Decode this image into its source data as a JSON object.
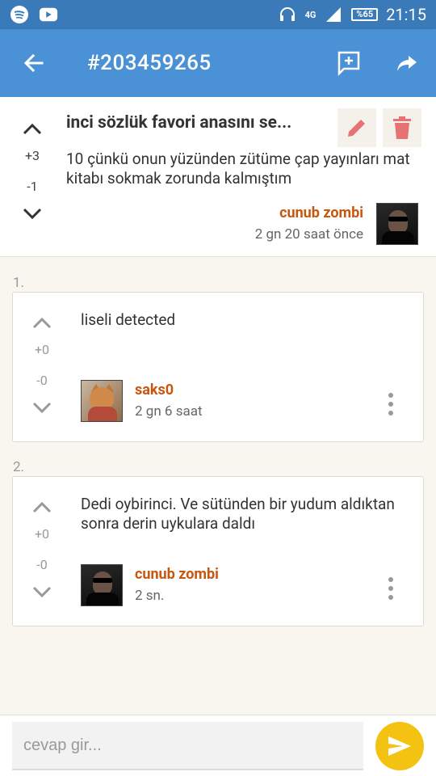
{
  "status_bar": {
    "network_label": "4G",
    "battery_label": "%65",
    "time": "21:15"
  },
  "app_bar": {
    "title": "#203459265"
  },
  "entry": {
    "title": "inci sözlük favori anasını se...",
    "text": "10 çünkü onun yüzünden zütüme çap yayınları mat kitabı sokmak zorunda kalmıştım",
    "upvotes": "+3",
    "downvotes": "-1",
    "author": "cunub zombi",
    "date": "2 gn 20 saat  önce"
  },
  "comments": [
    {
      "index": "1.",
      "text": "liseli detected",
      "upvotes": "+0",
      "downvotes": "-0",
      "author": "saks0",
      "date": "2 gn 6 saat"
    },
    {
      "index": "2.",
      "text": "Dedi oybirinci. Ve sütünden bir yudum aldıktan sonra derin uykulara daldı",
      "upvotes": "+0",
      "downvotes": "-0",
      "author": "cunub zombi",
      "date": "2 sn."
    }
  ],
  "reply": {
    "placeholder": "cevap gir..."
  },
  "colors": {
    "status_bar": "#3a7ab8",
    "app_bar": "#4a91d6",
    "author": "#c8570e",
    "send_button": "#f4c311",
    "action_icons": "#e57373",
    "background": "#f8f6ef"
  }
}
